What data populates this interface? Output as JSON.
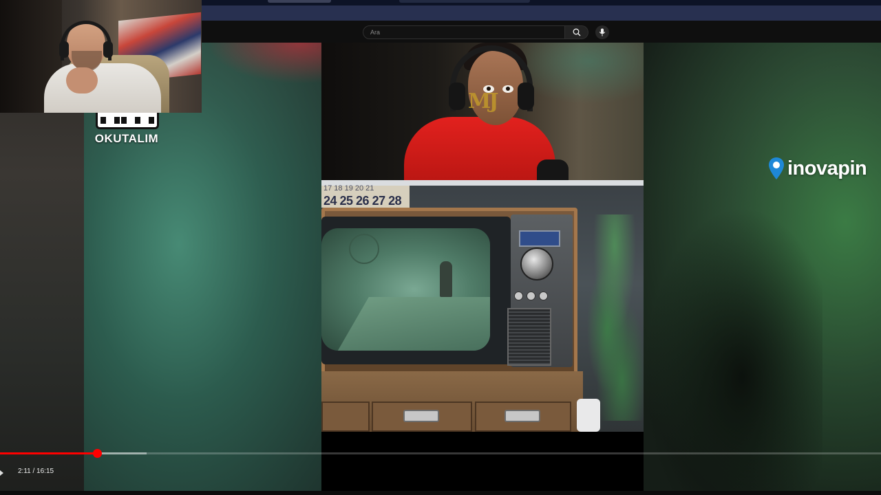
{
  "browser": {
    "search_placeholder": "Ara"
  },
  "overlay": {
    "qr_caption": "OKUTALIM",
    "sponsor_logo_text": "inovapin"
  },
  "video": {
    "time_display": "2:11 / 16:15",
    "current_time": "2:11",
    "duration": "16:15",
    "progress_fraction": 0.1345,
    "buffered_fraction": 0.165
  },
  "game": {
    "calendar_top_row": "17 18 19 20 21",
    "calendar_row": "24 25 26 27 28",
    "watermark": "MJ"
  },
  "colors": {
    "progress_red": "#ff0000",
    "header_bg": "#0f0f0f",
    "browser_bar": "#283050",
    "sponsor_pin": "#1e88d8"
  },
  "icons": {
    "search": "search-icon",
    "mic": "microphone-icon",
    "sponsor": "location-pin-icon"
  }
}
